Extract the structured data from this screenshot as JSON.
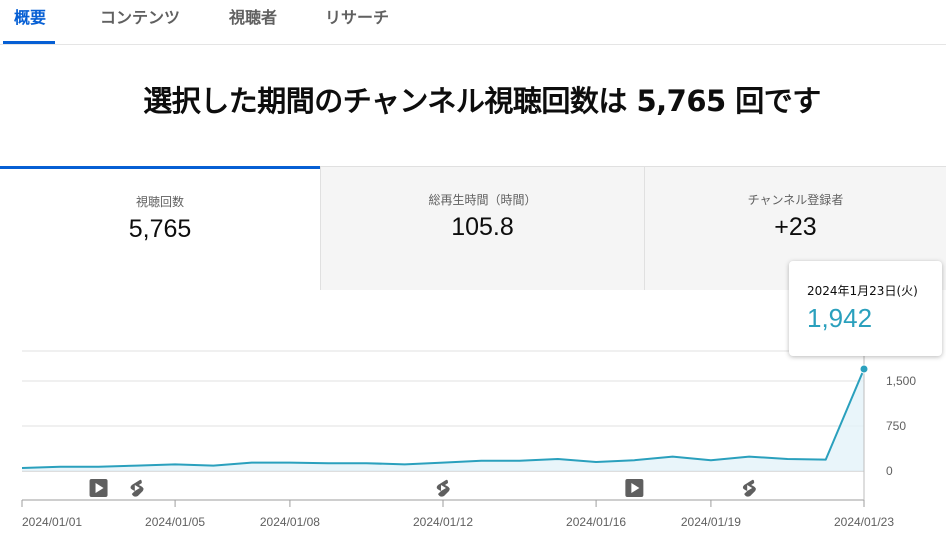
{
  "tabs": [
    {
      "label": "概要",
      "active": true
    },
    {
      "label": "コンテンツ",
      "active": false
    },
    {
      "label": "視聴者",
      "active": false
    },
    {
      "label": "リサーチ",
      "active": false
    }
  ],
  "headline": "選択した期間のチャンネル視聴回数は 5,765 回です",
  "metrics": [
    {
      "label": "視聴回数",
      "value": "5,765",
      "active": true
    },
    {
      "label": "総再生時間（時間）",
      "value": "105.8",
      "active": false
    },
    {
      "label": "チャンネル登録者",
      "value": "+23",
      "active": false
    }
  ],
  "tooltip": {
    "date": "2024年1月23日(火)",
    "value": "1,942"
  },
  "colors": {
    "accent": "#065fd4",
    "line": "#2aa0bd",
    "fill": "#e3f2f9"
  },
  "chart_data": {
    "type": "area",
    "x": [
      "2024/01/01",
      "2024/01/02",
      "2024/01/03",
      "2024/01/04",
      "2024/01/05",
      "2024/01/06",
      "2024/01/07",
      "2024/01/08",
      "2024/01/09",
      "2024/01/10",
      "2024/01/11",
      "2024/01/12",
      "2024/01/13",
      "2024/01/14",
      "2024/01/15",
      "2024/01/16",
      "2024/01/17",
      "2024/01/18",
      "2024/01/19",
      "2024/01/20",
      "2024/01/21",
      "2024/01/22",
      "2024/01/23"
    ],
    "values": [
      50,
      70,
      70,
      90,
      110,
      90,
      140,
      140,
      130,
      130,
      110,
      140,
      170,
      170,
      200,
      150,
      180,
      240,
      180,
      240,
      200,
      190,
      1700
    ],
    "xticks": [
      "2024/01/01",
      "2024/01/05",
      "2024/01/08",
      "2024/01/12",
      "2024/01/16",
      "2024/01/19",
      "2024/01/23"
    ],
    "yticks": [
      "0",
      "750",
      "1,500"
    ],
    "ylim": [
      0,
      2000
    ],
    "markers": [
      {
        "date": "2024/01/03",
        "icon": "video-icon"
      },
      {
        "date": "2024/01/04",
        "icon": "shorts-icon"
      },
      {
        "date": "2024/01/12",
        "icon": "shorts-icon"
      },
      {
        "date": "2024/01/17",
        "icon": "video-icon"
      },
      {
        "date": "2024/01/20",
        "icon": "shorts-icon"
      }
    ],
    "highlight": "2024/01/23"
  }
}
